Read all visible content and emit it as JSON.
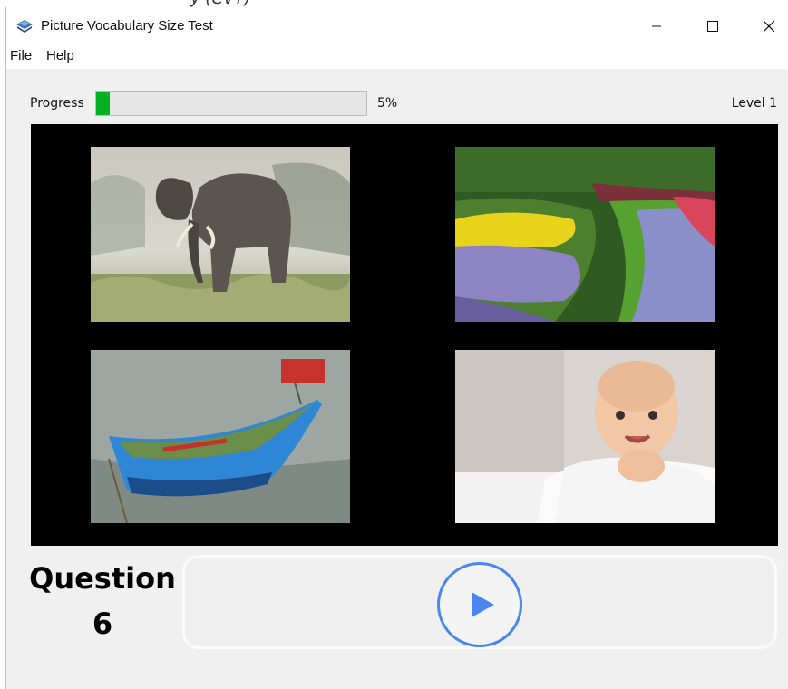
{
  "window": {
    "title": "Picture Vocabulary Size Test",
    "app_icon": "book-icon"
  },
  "menu": {
    "items": [
      {
        "label": "File"
      },
      {
        "label": "Help"
      }
    ]
  },
  "progress": {
    "label": "Progress",
    "percent_text": "5%",
    "value": 0.05,
    "color": "#06b025"
  },
  "level": {
    "text": "Level 1"
  },
  "pictures": [
    {
      "subject": "elephant"
    },
    {
      "subject": "garden"
    },
    {
      "subject": "boat"
    },
    {
      "subject": "baby"
    }
  ],
  "question": {
    "label": "Question",
    "number": "6"
  },
  "play": {
    "icon": "play-icon",
    "accent": "#4a86f0"
  }
}
